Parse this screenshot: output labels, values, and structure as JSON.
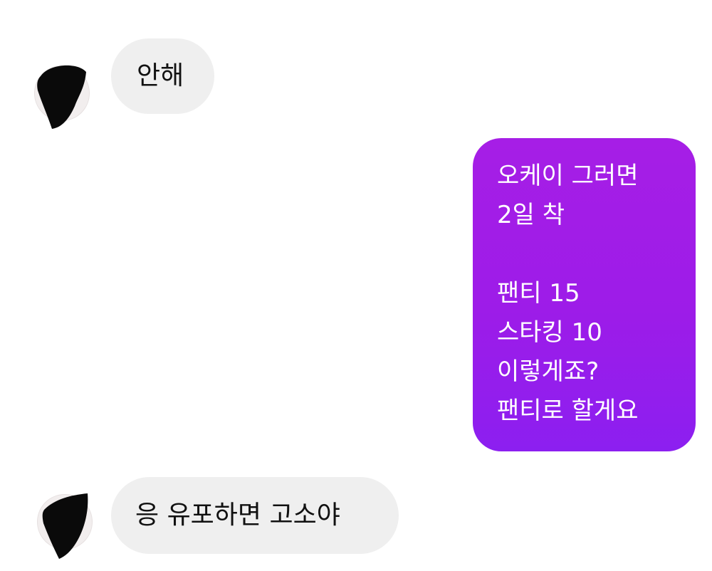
{
  "chat": {
    "messages": [
      {
        "sender": "other",
        "text": "안해"
      },
      {
        "sender": "me",
        "lines": [
          "오케이 그러면",
          "2일 착",
          "",
          "팬티 15",
          "스타킹 10",
          "이렇게죠?",
          "팬티로 할게요"
        ]
      },
      {
        "sender": "other",
        "text": "응 유포하면 고소야"
      }
    ]
  },
  "colors": {
    "incoming_bubble": "#efefef",
    "outgoing_bubble_top": "#a61ee6",
    "outgoing_bubble_bottom": "#8c1ff0"
  }
}
